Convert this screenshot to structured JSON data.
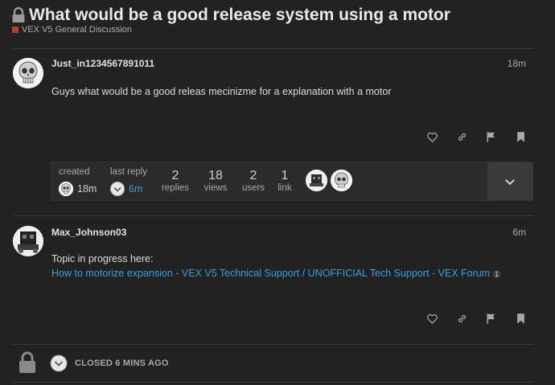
{
  "topic": {
    "title": "What would be a good release system using a motor",
    "category": "VEX V5 General Discussion",
    "category_color": "#c0392b"
  },
  "posts": [
    {
      "username": "Just_in1234567891011",
      "time": "18m",
      "body": "Guys what would be a good releas mecinizme for a explanation with a motor",
      "avatar_icon": "skull-avatar"
    },
    {
      "username": "Max_Johnson03",
      "time": "6m",
      "intro": "Topic in progress here:",
      "link_text": "How to motorize expansion - VEX V5 Technical Support / UNOFFICIAL Tech Support - VEX Forum",
      "link_clicks": "1",
      "avatar_icon": "robot-avatar"
    }
  ],
  "topic_map": {
    "created_label": "created",
    "created_time": "18m",
    "last_reply_label": "last reply",
    "last_reply_time": "6m",
    "replies_count": "2",
    "replies_label": "replies",
    "views_count": "18",
    "views_label": "views",
    "users_count": "2",
    "users_label": "users",
    "links_count": "1",
    "links_label": "link"
  },
  "footer": {
    "closed_text": "CLOSED 6 MINS AGO"
  },
  "icons": {
    "post_actions": [
      "heart-icon",
      "link-icon",
      "flag-icon",
      "bookmark-icon"
    ]
  }
}
